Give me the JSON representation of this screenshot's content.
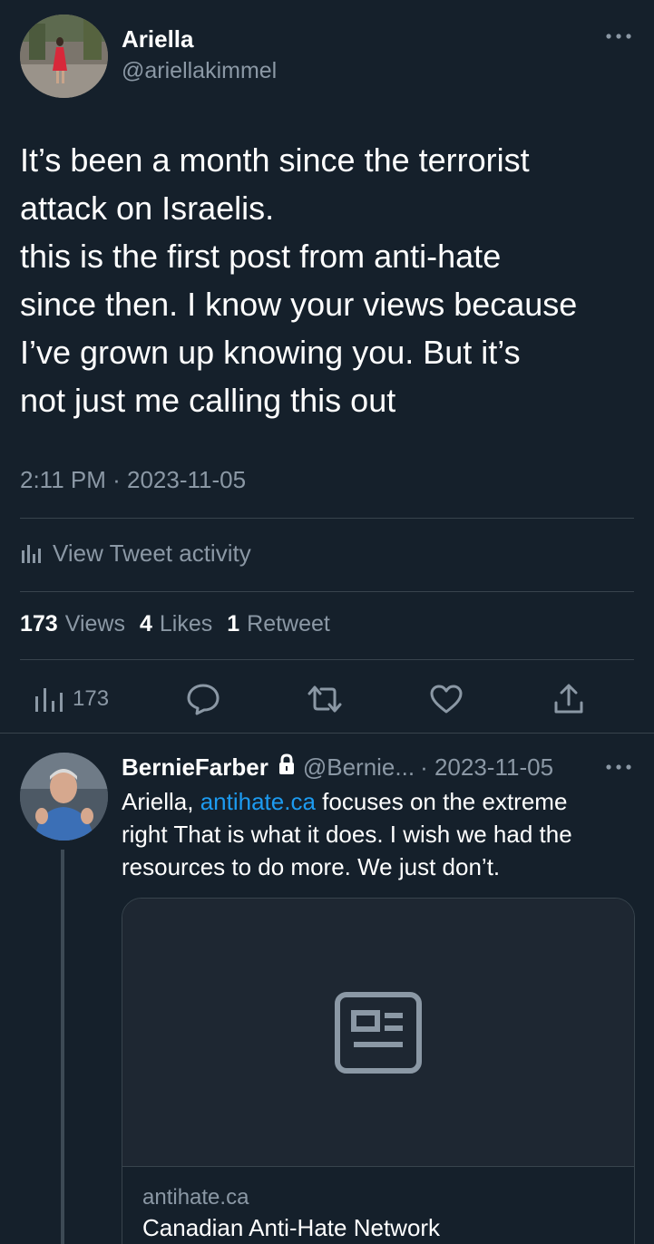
{
  "main_tweet": {
    "author_name": "Ariella",
    "author_handle": "@ariellakimmel",
    "text_lines": [
      "It’s been a month since the terrorist",
      "attack on Israelis.",
      "this is the first post from anti-hate",
      "since then. I know your views because",
      "I’ve grown up knowing you. But it’s",
      "not just me calling this out"
    ],
    "timestamp": "2:11 PM · 2023-11-05",
    "activity_label": "View Tweet activity",
    "stats": {
      "views_count": "173",
      "views_label": "Views",
      "likes_count": "4",
      "likes_label": "Likes",
      "retweets_count": "1",
      "retweets_label": "Retweet"
    },
    "actions": {
      "views_count": "173"
    }
  },
  "reply": {
    "author_name": "BernieFarber",
    "author_handle": "@Bernie...",
    "date": "· 2023-11-05",
    "line1_prefix": "Ariella, ",
    "line1_link": "antihate.ca",
    "line1_suffix": " focuses on the extreme",
    "line2": "right That is what it does. I wish we had the",
    "line3": "resources to do more.  We just don’t.",
    "card": {
      "domain": "antihate.ca",
      "title": "Canadian Anti-Hate Network"
    }
  },
  "colors": {
    "background": "#15202b",
    "muted_text": "#8b98a5",
    "link": "#1d9bf0",
    "divider": "#38444d"
  },
  "icons": [
    "more-icon",
    "analytics-icon",
    "reply-icon",
    "retweet-icon",
    "like-icon",
    "share-icon",
    "lock-icon",
    "news-article-icon"
  ]
}
